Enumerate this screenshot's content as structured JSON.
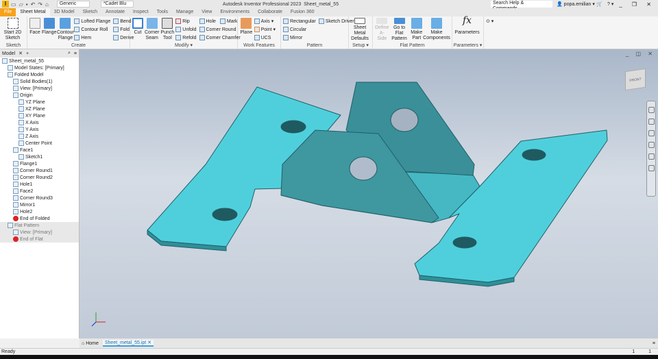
{
  "title": {
    "app_icon": "I",
    "material": "Generic",
    "appearance": "*Cadet Blu",
    "app_name": "Autodesk Inventor Professional 2023",
    "doc_name": "Sheet_metal_55",
    "search_placeholder": "Search Help & Commands...",
    "user": "popa.emilian"
  },
  "tabs": [
    "File",
    "Sheet Metal",
    "3D Model",
    "Sketch",
    "Annotate",
    "Inspect",
    "Tools",
    "Manage",
    "View",
    "Environments",
    "Collaborate",
    "Fusion 360"
  ],
  "ribbon": {
    "sketch": {
      "label": "Sketch",
      "start": "Start 2D Sketch"
    },
    "create": {
      "label": "Create",
      "face": "Face",
      "flange": "Flange",
      "contour": "Contour Flange",
      "lofted": "Lofted Flange",
      "contour_roll": "Contour Roll",
      "hem": "Hem",
      "bend": "Bend",
      "fold": "Fold",
      "derive": "Derive"
    },
    "modify": {
      "label": "Modify ▾",
      "cut": "Cut",
      "corner_seam": "Corner Seam",
      "punch": "Punch Tool",
      "rip": "Rip",
      "unfold": "Unfold",
      "refold": "Refold",
      "hole": "Hole",
      "mark": "Mark",
      "corner_round": "Corner Round",
      "corner_chamfer": "Corner Chamfer"
    },
    "work": {
      "label": "Work Features",
      "plane": "Plane",
      "axis": "Axis ▾",
      "point": "Point ▾",
      "ucs": "UCS"
    },
    "pattern": {
      "label": "Pattern",
      "rect": "Rectangular",
      "circ": "Circular",
      "mirror": "Mirror",
      "sketch_driven": "Sketch Driven"
    },
    "setup": {
      "label": "Setup ▾",
      "defaults": "Sheet Metal Defaults"
    },
    "flat": {
      "label": "Flat Pattern",
      "define": "Define A-Side",
      "goto": "Go to Flat Pattern",
      "make_part": "Make Part",
      "make_comp": "Make Components"
    },
    "params": {
      "label": "Parameters ▾",
      "parameters": "Parameters",
      "fx": "fx"
    }
  },
  "browser": {
    "tab": "Model",
    "nodes": [
      {
        "t": "Sheet_metal_55",
        "d": 0
      },
      {
        "t": "Model States: [Primary]",
        "d": 1
      },
      {
        "t": "Folded Model",
        "d": 1
      },
      {
        "t": "Solid Bodies(1)",
        "d": 2
      },
      {
        "t": "View: [Primary]",
        "d": 2
      },
      {
        "t": "Origin",
        "d": 2
      },
      {
        "t": "YZ Plane",
        "d": 3
      },
      {
        "t": "XZ Plane",
        "d": 3
      },
      {
        "t": "XY Plane",
        "d": 3
      },
      {
        "t": "X Axis",
        "d": 3
      },
      {
        "t": "Y Axis",
        "d": 3
      },
      {
        "t": "Z Axis",
        "d": 3
      },
      {
        "t": "Center Point",
        "d": 3
      },
      {
        "t": "Face1",
        "d": 2
      },
      {
        "t": "Sketch1",
        "d": 3
      },
      {
        "t": "Flange1",
        "d": 2
      },
      {
        "t": "Corner Round1",
        "d": 2
      },
      {
        "t": "Corner Round2",
        "d": 2
      },
      {
        "t": "Hole1",
        "d": 2
      },
      {
        "t": "Face2",
        "d": 2
      },
      {
        "t": "Corner Round3",
        "d": 2
      },
      {
        "t": "Mirror1",
        "d": 2
      },
      {
        "t": "Hole2",
        "d": 2
      },
      {
        "t": "End of Folded",
        "d": 2
      },
      {
        "t": "Flat Pattern",
        "d": 1
      },
      {
        "t": "View: [Primary]",
        "d": 2
      },
      {
        "t": "End of Flat",
        "d": 2
      }
    ]
  },
  "viewcube": "FRONT",
  "doc_tabs": {
    "home": "Home",
    "doc": "Sheet_metal_55.ipt"
  },
  "status": {
    "text": "Ready",
    "n1": "1",
    "n2": "1"
  },
  "colors": {
    "part": "#4fcfdc",
    "gusset": "#3a8f98",
    "accent": "#f7a21b"
  }
}
